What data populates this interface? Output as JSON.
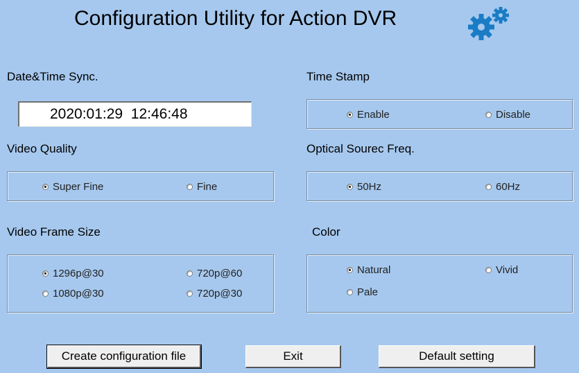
{
  "window": {
    "title": "Configuration Utility for Action DVR",
    "accent_color": "#1a7cc4"
  },
  "datetime_sync": {
    "label": "Date&Time Sync.",
    "value": "2020:01:29  12:46:48"
  },
  "time_stamp": {
    "label": "Time Stamp",
    "options": [
      "Enable",
      "Disable"
    ],
    "selected": "Enable"
  },
  "video_quality": {
    "label": "Video Quality",
    "options": [
      "Super Fine",
      "Fine"
    ],
    "selected": "Super Fine"
  },
  "optical_freq": {
    "label": "Optical Sourec Freq.",
    "options": [
      "50Hz",
      "60Hz"
    ],
    "selected": "50Hz"
  },
  "frame_size": {
    "label": "Video Frame Size",
    "options": [
      "1296p@30",
      "720p@60",
      "1080p@30",
      "720p@30"
    ],
    "selected": "1296p@30"
  },
  "color": {
    "label": "Color",
    "options": [
      "Natural",
      "Vivid",
      "Pale"
    ],
    "selected": "Natural"
  },
  "buttons": {
    "create": "Create configuration file",
    "exit": "Exit",
    "default": "Default setting"
  },
  "icons": {
    "settings": "gears-icon"
  }
}
